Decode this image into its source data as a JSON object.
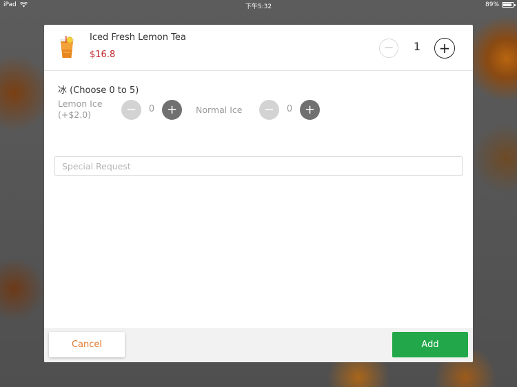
{
  "status_bar": {
    "device": "iPad",
    "time": "下午5:32",
    "battery": "89%",
    "battery_level": 0.89
  },
  "item": {
    "name": "Iced Fresh Lemon Tea",
    "price": "$16.8",
    "quantity": "1",
    "icon": "lemon-tea-cup-icon"
  },
  "option_group": {
    "title": "冰 (Choose 0 to 5)",
    "options": [
      {
        "label_line1": "Lemon Ice",
        "label_line2": "(+$2.0)",
        "count": "0"
      },
      {
        "label_line1": "Normal Ice",
        "label_line2": "",
        "count": "0"
      }
    ]
  },
  "special_request": {
    "placeholder": "Special Request",
    "value": ""
  },
  "footer": {
    "cancel_label": "Cancel",
    "add_label": "Add"
  },
  "colors": {
    "price": "#c0282d",
    "cancel_text": "#e0782a",
    "add_button": "#22a84a"
  }
}
